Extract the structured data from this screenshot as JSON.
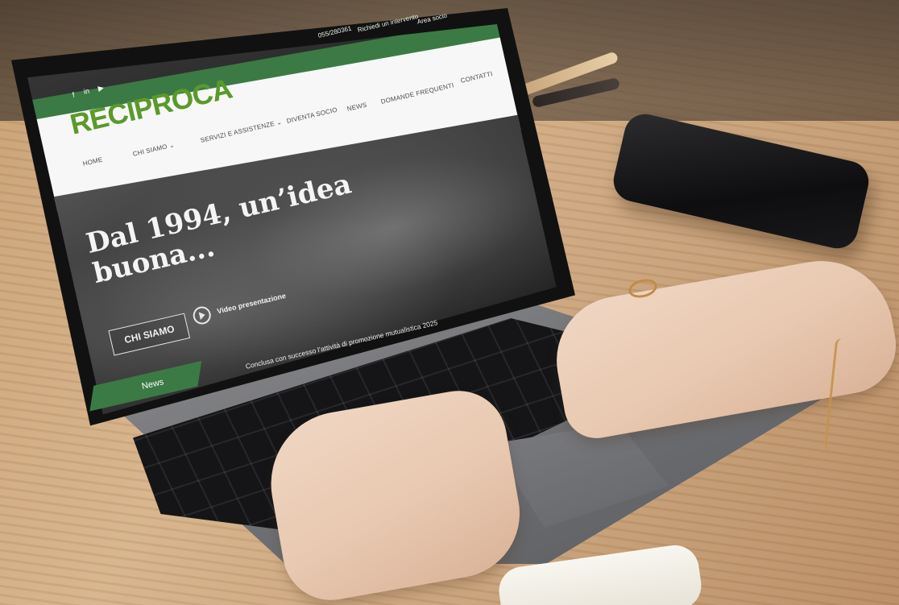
{
  "website": {
    "topbar": {
      "phone": "055/280361",
      "request": "Richiedi un intervento",
      "member_area": "Area socio"
    },
    "logo_text": "RECIPROCA",
    "social": [
      "f",
      "in",
      "▶"
    ],
    "nav": [
      "HOME",
      "CHI SIAMO ⌄",
      "SERVIZI E ASSISTENZE ⌄",
      "DIVENTA SOCIO",
      "NEWS",
      "DOMANDE FREQUENTI",
      "CONTATTI"
    ],
    "hero": {
      "headline": "Dal 1994, un’idea\nbuona...",
      "cta": "CHI SIAMO",
      "video": "Video presentazione"
    },
    "news_bar": {
      "label": "News",
      "ticker": "Conclusa con successo l’attività di promozione mutualistica 2025"
    }
  },
  "colors": {
    "brand_green": "#3b7a44",
    "logo_green": "#5a9a2a"
  }
}
